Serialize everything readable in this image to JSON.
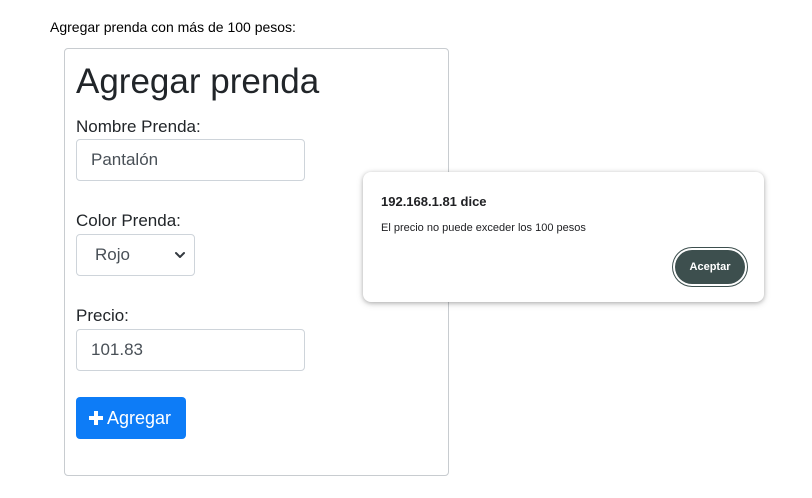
{
  "caption": "Agregar prenda con más de 100 pesos:",
  "form": {
    "title": "Agregar prenda",
    "nombre_label": "Nombre Prenda:",
    "nombre_value": "Pantalón",
    "color_label": "Color Prenda:",
    "color_value": "Rojo",
    "precio_label": "Precio:",
    "precio_value": "101.83",
    "submit_label": "Agregar",
    "submit_icon": "plus-icon"
  },
  "dialog": {
    "origin": "192.168.1.81 dice",
    "message": "El precio no puede exceder los 100 pesos",
    "ok_label": "Aceptar"
  },
  "colors": {
    "primary": "#0d7cf7",
    "dialog_button": "#3d4f4e"
  }
}
